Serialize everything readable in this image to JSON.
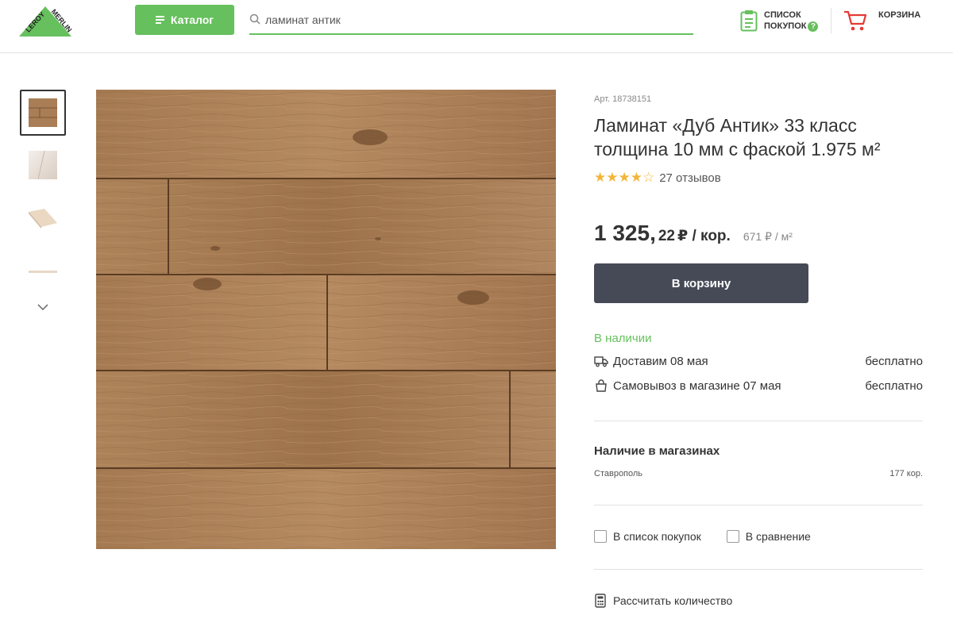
{
  "header": {
    "logo_text": "LEROY MERLIN",
    "catalog_label": "Каталог",
    "search_value": "ламинат антик",
    "shopping_list_line1": "СПИСОК",
    "shopping_list_line2": "ПОКУПОК",
    "help_badge": "?",
    "cart_label": "КОРЗИНА"
  },
  "gallery": {
    "thumbnails": [
      "wood-texture",
      "white-plank",
      "profile-view",
      "edge-view"
    ]
  },
  "product": {
    "article": "Арт. 18738151",
    "title": "Ламинат «Дуб Антик» 33 класс толщина 10 мм с фаской 1.975 м²",
    "stars": "★★★★☆",
    "reviews": "27 отзывов",
    "price_int": "1 325,",
    "price_dec": "22",
    "price_unit": "₽ / кор.",
    "price_m2": "671 ₽ / м²",
    "buy_label": "В корзину",
    "stock_status": "В наличии",
    "delivery_text": "Доставим 08 мая",
    "delivery_price": "бесплатно",
    "pickup_text": "Самовывоз в магазине 07 мая",
    "pickup_price": "бесплатно",
    "availability_title": "Наличие в магазинах",
    "city": "Ставрополь",
    "city_qty": "177 кор.",
    "add_list_label": "В список покупок",
    "compare_label": "В сравнение",
    "calc_label": "Рассчитать количество"
  },
  "colors": {
    "brand_green": "#66c05d",
    "button_dark": "#464a57",
    "star": "#f2b53a"
  }
}
